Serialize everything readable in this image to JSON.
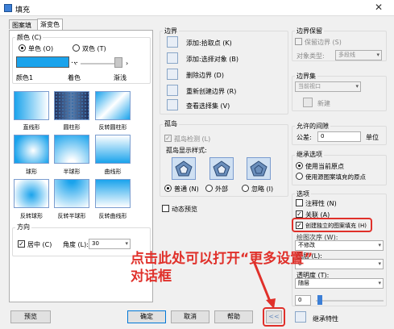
{
  "window": {
    "title": "填充"
  },
  "tabs": [
    "图案填充",
    "渐变色"
  ],
  "color": {
    "group": "颜色 (C)",
    "single": "单色 (O)",
    "dual": "双色 (T)",
    "color1": "颜色1",
    "dark": "着色",
    "light": "渐浅",
    "color1_hex": "#1aa3ec"
  },
  "gradients": [
    "直线形",
    "圆柱形",
    "反转圆柱形",
    "球形",
    "半球形",
    "曲线形",
    "反转球形",
    "反转半球形",
    "反转曲线形"
  ],
  "direction": {
    "group": "方向",
    "center": "居中 (C)",
    "angle_label": "角度 (L):",
    "angle_value": "30"
  },
  "boundary": {
    "group": "边界",
    "pick": "添加:拾取点 (K)",
    "select": "添加:选择对象 (B)",
    "remove": "删除边界 (D)",
    "recreate": "重新创建边界 (R)",
    "view": "查看选择集 (V)"
  },
  "islands": {
    "group": "孤岛",
    "detect": "孤岛检测 (L)",
    "style_label": "孤岛显示样式:",
    "normal": "普通 (N)",
    "outer": "外部",
    "ignore": "忽略 (I)"
  },
  "preview_dynamic": "动态预览",
  "boundary_keep": {
    "group": "边界保留",
    "keep": "保留边界 (S)",
    "type_label": "对象类型:",
    "type_value": "多段线"
  },
  "boundary_set": {
    "group": "边界集",
    "value": "当前视口",
    "new": "新建"
  },
  "gap": {
    "group": "允许的间隙",
    "tol_label": "公差:",
    "tol_value": "0",
    "unit": "单位"
  },
  "inherit": {
    "group": "继承选项",
    "use_current": "使用当前原点",
    "use_source": "使用源图案填充的原点"
  },
  "options": {
    "group": "选项",
    "annotative": "注释性 (N)",
    "associative": "关联 (A)",
    "separate": "创建独立的图案填充 (H)",
    "draw_order_label": "绘图次序 (W):",
    "draw_order": "不修改",
    "layer_label": "图层 (L):",
    "layer": "0",
    "transparency_label": "透明度 (T):",
    "transparency": "随层",
    "transparency_value": "0"
  },
  "inherit_props": "继承特性",
  "buttons": {
    "preview": "预览",
    "ok": "确定",
    "cancel": "取消",
    "help": "帮助",
    "more": "<<"
  },
  "annotation": {
    "line1": "点击此处可以打开“更多设置”",
    "line2": "对话框"
  }
}
